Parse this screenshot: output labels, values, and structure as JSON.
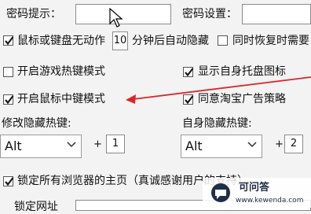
{
  "password_hint_label": "密码提示：",
  "password_settings_label": "密码设置：",
  "idle_row": {
    "label_before": "鼠标或键盘无动作",
    "minutes_value": "10",
    "label_after": "分钟后自动隐藏",
    "restore_label": "同时恢复时需要"
  },
  "options": {
    "game_hotkey_mode": "开启游戏热键模式",
    "show_tray_icon": "显示自身托盘图标",
    "middle_click_mode": "开启鼠标中键模式",
    "agree_ad_policy": "同意淘宝广告策略"
  },
  "modify_hotkey": {
    "label": "修改隐藏热键:",
    "modifier": "Alt",
    "plus": "+",
    "key": "1"
  },
  "self_hotkey": {
    "label": "自身隐藏热键:",
    "modifier": "Alt",
    "plus": "+",
    "key": "2"
  },
  "lock_homepage_label": "锁定所有浏览器的主页（真诚感谢用户的支持）",
  "bottom_partial_label": "锁定网址",
  "watermark": {
    "brand": "可问答",
    "domain": "www.kewenda.com"
  },
  "colors": {
    "arrow": "#d9262c",
    "check": "#1a1a1a"
  }
}
